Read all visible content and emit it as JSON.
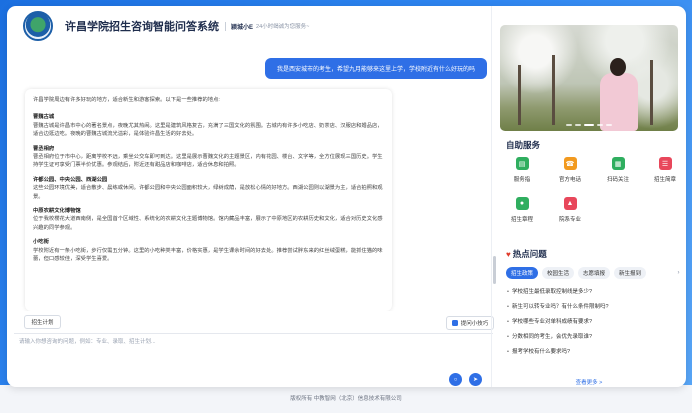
{
  "header": {
    "title": "许昌学院招生咨询智能问答系统",
    "brand": "颍城小E",
    "tagline": "24小时竭诚为您服务~"
  },
  "chat": {
    "user_message": "我是西安城市的考生，希望九月能够来这里上学，学校附近有什么好玩的吗",
    "bot_intro": "许昌学院周边有许多好玩的地方，适合新生和游客探索。以下是一些推荐的地点:",
    "bot_sections": [
      {
        "title": "曹魏古城",
        "text": "曹魏古城是许昌市中心的著名景点，夜晚尤其热闹。这里是建筑风格复古，充满了三国文化的氛围。古城内有许多小吃店、奶茶店、汉服店和婚品店，适合边逛边吃。夜晚的曹魏古城流光溢彩，是体验许昌生活的好去处。"
      },
      {
        "title": "曹丞相府",
        "text": "曹丞相府位于市中心，距离学校不远，乘坐公交车即可到达。这里是展示曹魏文化的主题景区，内有花园、楼台、文字等，全方位展现三国历史。学生持学生证可享受门票半价优惠。参观结后，附近还有甜品店和咖啡店，适合休息和拍照。"
      },
      {
        "title": "许都公园、中央公园、西湖公园",
        "text": "这些公园环境优美，适合散步、晨练或休闲。许都公园和中央公园面积较大，绿树成荫，是放松心情的好地方。西湖公园则以湖景为主，适合拍照和观景。"
      },
      {
        "title": "中原农耕文化博物馆",
        "text": "位于我校櫻花大道西南侧，是全国首个区域性、系统化的农耕文化主题博物馆。馆内藏品丰富，展示了中原地区的农耕历史和文化，适合对历史文化感兴趣的同学参观。"
      },
      {
        "title": "小吃街",
        "text": "学校附近有一条小吃街，步行仅需五分钟。这里的小吃种类丰富，价格实惠，是学生课余时间的好去处。推荐尝试胖东来的红丝绒蛋糕，能抓住猫的味蕾，但口感较佳，深受学生喜爱。"
      }
    ]
  },
  "chips": {
    "trip": "招生计划",
    "tips": "提问小技巧"
  },
  "input": {
    "placeholder": "请输入你想咨询的问题，例如：专业、录取、招生计划..."
  },
  "sidebar": {
    "services_title": "自助服务",
    "services": [
      {
        "label": "服务指",
        "icon": "chat-icon",
        "color": "#2fae5f"
      },
      {
        "label": "官方电话",
        "icon": "phone-icon",
        "color": "#f29a1f"
      },
      {
        "label": "扫码关注",
        "icon": "qrcode-icon",
        "color": "#2fae5f"
      },
      {
        "label": "招生简章",
        "icon": "document-icon",
        "color": "#e8475b"
      },
      {
        "label": "招生章程",
        "icon": "user-icon",
        "color": "#2fae5f"
      },
      {
        "label": "院系专业",
        "icon": "school-icon",
        "color": "#e8475b"
      }
    ],
    "hot_title": "热点问题",
    "tabs": [
      "招生政策",
      "校园生活",
      "志愿填报",
      "新生报到"
    ],
    "questions": [
      "学校招生最低录取控制线是多少?",
      "新生可以转专业吗？有什么条件限制吗?",
      "学校哪些专业对单科成绩有要求?",
      "分数相同的考生，会优先录取谁?",
      "报考学校有什么要求吗?"
    ],
    "more": "查看更多 >"
  },
  "footer": "版权所有 中教智网（北京）信息技术有限公司"
}
